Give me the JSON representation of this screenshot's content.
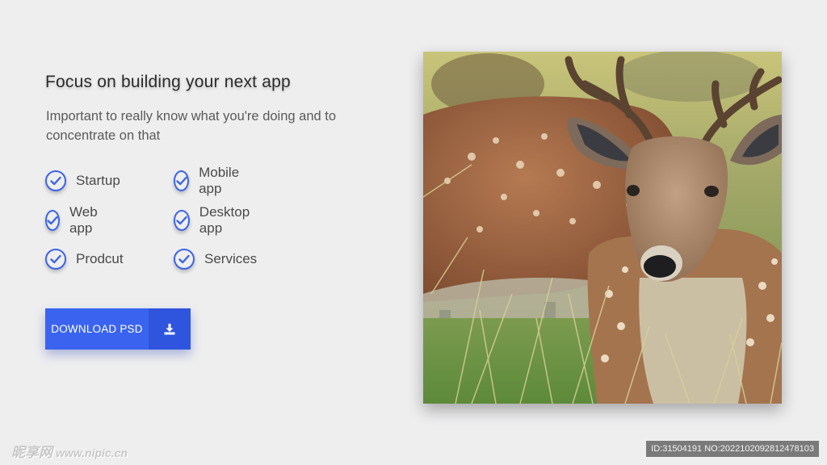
{
  "hero": {
    "title": "Focus on building your next app",
    "subtitle": "Important to really know what you're doing and to concentrate on that"
  },
  "features": [
    {
      "label": "Startup"
    },
    {
      "label": "Mobile app"
    },
    {
      "label": "Web app"
    },
    {
      "label": "Desktop app"
    },
    {
      "label": "Prodcut"
    },
    {
      "label": "Services"
    }
  ],
  "cta": {
    "label": "DOWNLOAD PSD",
    "icon": "download-icon"
  },
  "image": {
    "subject": "deer-photo"
  },
  "watermark": {
    "brand": "昵享网",
    "url": "www.nipic.cn",
    "id_text": "ID:31504191 NO:20221020928124781​03"
  },
  "colors": {
    "accent": "#3a63f0",
    "accent_dark": "#2f55df",
    "background": "#eeeeef"
  }
}
